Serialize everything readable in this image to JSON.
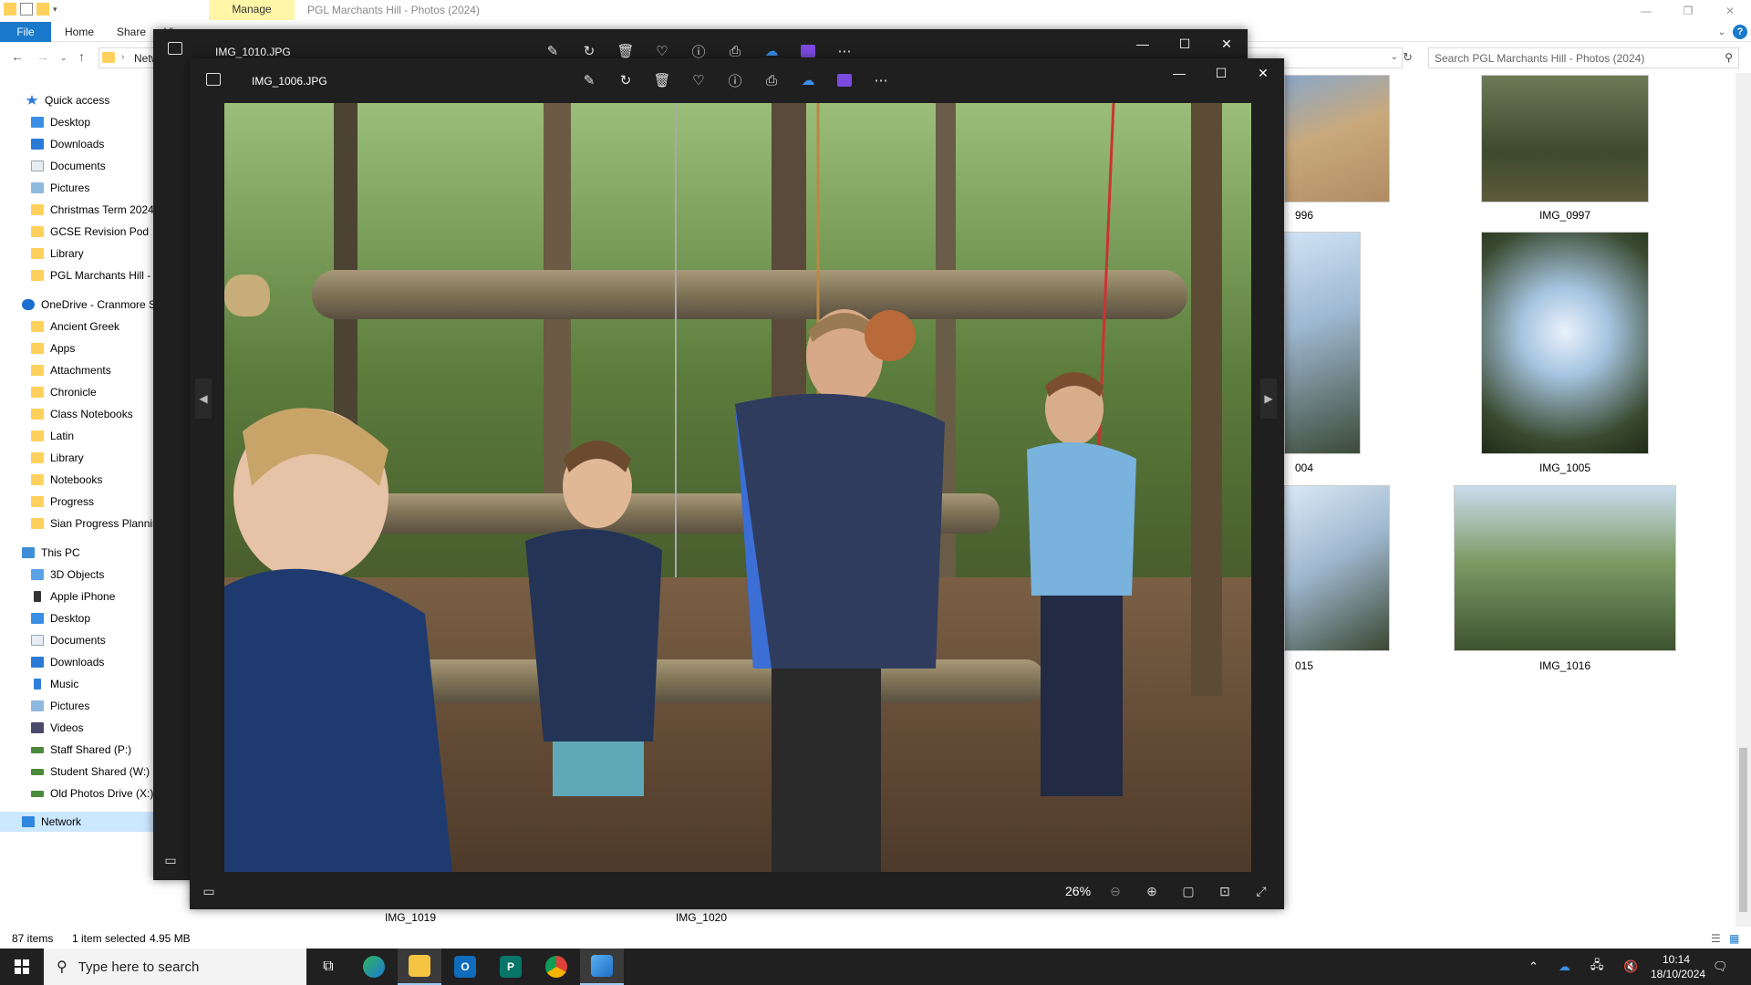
{
  "explorer": {
    "window_title": "PGL Marchants Hill - Photos (2024)",
    "manage_tab": "Manage",
    "tabs": [
      "File",
      "Home",
      "Share",
      "Vi"
    ],
    "address_crumb": "Netw",
    "search_placeholder": "Search PGL Marchants Hill - Photos (2024)",
    "sidebar": {
      "quick_access": "Quick access",
      "quick_items": [
        "Desktop",
        "Downloads",
        "Documents",
        "Pictures",
        "Christmas Term 2024",
        "GCSE Revision Pod",
        "Library",
        "PGL Marchants Hill - P"
      ],
      "onedrive": "OneDrive - Cranmore S",
      "onedrive_items": [
        "Ancient Greek",
        "Apps",
        "Attachments",
        "Chronicle",
        "Class Notebooks",
        "Latin",
        "Library",
        "Notebooks",
        "Progress",
        "Sian Progress Planning"
      ],
      "this_pc": "This PC",
      "pc_items": [
        "3D Objects",
        "Apple iPhone",
        "Desktop",
        "Documents",
        "Downloads",
        "Music",
        "Pictures",
        "Videos",
        "Staff Shared (P:)",
        "Student Shared (W:)",
        "Old Photos Drive (X:)"
      ],
      "network": "Network"
    },
    "thumbnails": [
      "996",
      "IMG_0997",
      "004",
      "IMG_1005",
      "015",
      "IMG_1016",
      "IMG_1019",
      "IMG_1020"
    ],
    "status": {
      "items": "87 items",
      "selected": "1 item selected",
      "size": "4.95 MB"
    }
  },
  "photos_back": {
    "filename": "IMG_1010.JPG"
  },
  "photos_front": {
    "filename": "IMG_1006.JPG",
    "zoom": "26%"
  },
  "taskbar": {
    "search_placeholder": "Type here to search",
    "time": "10:14",
    "date": "18/10/2024"
  }
}
